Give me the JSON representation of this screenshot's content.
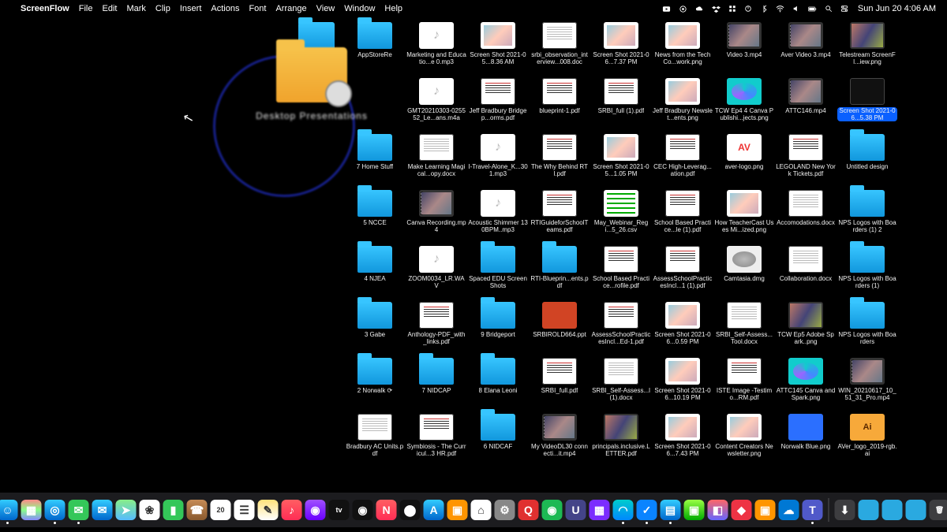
{
  "menubar": {
    "app_name": "ScreenFlow",
    "items": [
      "File",
      "Edit",
      "Mark",
      "Clip",
      "Insert",
      "Actions",
      "Font",
      "Arrange",
      "View",
      "Window",
      "Help"
    ],
    "clock": "Sun Jun 20  4:06 AM",
    "status_icons": [
      "youtube",
      "record",
      "cloud",
      "dropbox",
      "grid",
      "toggl",
      "bluetooth",
      "wifi",
      "volume",
      "battery",
      "search",
      "control-center"
    ]
  },
  "zoom_label": "Desktop Presentations",
  "grid": [
    [
      {
        "kind": "folder",
        "label": "AppStoreRe"
      },
      {
        "kind": "audio",
        "label": "Marketing and Educatio...e 0.mp3"
      },
      {
        "kind": "img",
        "label": "Screen Shot 2021-05...8.36 AM"
      },
      {
        "kind": "doc",
        "label": "srbi_observation_interview...008.doc"
      },
      {
        "kind": "img",
        "label": "Screen Shot 2021-06...7.37 PM"
      },
      {
        "kind": "img",
        "label": "News from the Tech Co...work.png"
      },
      {
        "kind": "video",
        "label": "Video 3.mp4"
      },
      {
        "kind": "video",
        "label": "Aver Video 3.mp4"
      },
      {
        "kind": "photo",
        "label": "Telestream ScreenFl...iew.png"
      }
    ],
    [
      {
        "kind": "empty",
        "label": ""
      },
      {
        "kind": "audio",
        "label": "GMT20210303-025552_Le...ans.m4a"
      },
      {
        "kind": "pdf",
        "label": "Jeff Bradbury Bridgep...orms.pdf"
      },
      {
        "kind": "pdf",
        "label": "blueprint-1.pdf"
      },
      {
        "kind": "pdf",
        "label": "SRBI_full (1).pdf"
      },
      {
        "kind": "img",
        "label": "Jeff Bradbury Newslet...ents.png"
      },
      {
        "kind": "canva",
        "label": "TCW Ep4 4 Canva Publishi...jects.png"
      },
      {
        "kind": "video",
        "label": "ATTC146.mp4"
      },
      {
        "kind": "dark",
        "label": "Screen Shot 2021-06...5.38 PM",
        "selected": true
      }
    ],
    [
      {
        "kind": "folder",
        "label": "7 Home Stuff"
      },
      {
        "kind": "doc",
        "label": "Make Learning Magical...opy.docx"
      },
      {
        "kind": "audio",
        "label": "I-Travel-Alone_K...301.mp3"
      },
      {
        "kind": "pdf",
        "label": "The Why Behind RTI.pdf"
      },
      {
        "kind": "img",
        "label": "Screen Shot 2021-05...1.05 PM"
      },
      {
        "kind": "pdf",
        "label": "CEC High-Leverag...ation.pdf"
      },
      {
        "kind": "aver",
        "label": "aver-logo.png"
      },
      {
        "kind": "pdf",
        "label": "LEGOLAND New York Tickets.pdf"
      },
      {
        "kind": "folder",
        "label": "Untitled design"
      }
    ],
    [
      {
        "kind": "folder",
        "label": "5 NCCE"
      },
      {
        "kind": "video",
        "label": "Canva Recording.mp4"
      },
      {
        "kind": "audio",
        "label": "Acoustic Shimmer 130BPM..mp3"
      },
      {
        "kind": "pdf",
        "label": "RTIGuideforSchoolTeams.pdf"
      },
      {
        "kind": "spread",
        "label": "May_Webinar_Regi...5_26.csv"
      },
      {
        "kind": "pdf",
        "label": "School Based Practice...le (1).pdf"
      },
      {
        "kind": "img",
        "label": "How TeacherCast Uses Mi...ized.png"
      },
      {
        "kind": "doc",
        "label": "Accomodations.docx"
      },
      {
        "kind": "folder",
        "label": "NPS Logos with Boarders (1) 2"
      }
    ],
    [
      {
        "kind": "folder",
        "label": "4 NJEA"
      },
      {
        "kind": "audio",
        "label": "ZOOM0034_LR.WAV"
      },
      {
        "kind": "folder",
        "label": "Spaced EDU Screen Shots"
      },
      {
        "kind": "folder",
        "label": "RTI-Blueprin...ents.pdf"
      },
      {
        "kind": "pdf",
        "label": "School Based Practice...rofile.pdf"
      },
      {
        "kind": "pdf",
        "label": "AssessSchoolPracticesIncl...1 (1).pdf"
      },
      {
        "kind": "dmg",
        "label": "Camtasia.dmg"
      },
      {
        "kind": "doc",
        "label": "Collaboration.docx"
      },
      {
        "kind": "folder",
        "label": "NPS Logos with Boarders (1)"
      }
    ],
    [
      {
        "kind": "folder",
        "label": "3 Gabe"
      },
      {
        "kind": "pdf",
        "label": "Anthology-PDF_with_links.pdf"
      },
      {
        "kind": "folder",
        "label": "9 Bridgeport"
      },
      {
        "kind": "ppt",
        "label": "SRBIROLD664.ppt"
      },
      {
        "kind": "pdf",
        "label": "AssessSchoolPracticesIncl...Ed-1.pdf"
      },
      {
        "kind": "img",
        "label": "Screen Shot 2021-06...0.59 PM"
      },
      {
        "kind": "doc",
        "label": "SRBI_Self-Assess...Tool.docx"
      },
      {
        "kind": "photo",
        "label": "TCW Ep5 Adobe Spark..png"
      },
      {
        "kind": "folder",
        "label": "NPS Logos with Boarders"
      }
    ],
    [
      {
        "kind": "folder",
        "label": "2 Norwalk ⟳"
      },
      {
        "kind": "folder",
        "label": "7 NIDCAP"
      },
      {
        "kind": "folder",
        "label": "8 Elana Leoni"
      },
      {
        "kind": "pdf",
        "label": "SRBI_full.pdf"
      },
      {
        "kind": "doc",
        "label": "SRBI_Self-Assess...l (1).docx"
      },
      {
        "kind": "img",
        "label": "Screen Shot 2021-06...10.19 PM"
      },
      {
        "kind": "pdf",
        "label": "ISTE Image -Testimo...RM.pdf"
      },
      {
        "kind": "canva",
        "label": "ATTC145 Canva and Spark.png"
      },
      {
        "kind": "video",
        "label": "WIN_20210617_10_51_31_Pro.mp4"
      }
    ],
    [
      {
        "kind": "doc",
        "label": "Bradbury AC Units.pdf"
      },
      {
        "kind": "pdf",
        "label": "Symbiosis - The Curricul...3 HR.pdf"
      },
      {
        "kind": "folder",
        "label": "6 NIDCAF"
      },
      {
        "kind": "video",
        "label": "My VideoDL30 connecti...it.mp4"
      },
      {
        "kind": "photo",
        "label": "principals.inclusive.LETTER.pdf"
      },
      {
        "kind": "img",
        "label": "Screen Shot 2021-06...7.43 PM"
      },
      {
        "kind": "img",
        "label": "Content Creators Newsletter.png"
      },
      {
        "kind": "blue",
        "label": "Norwalk Blue.png"
      },
      {
        "kind": "ai",
        "label": "AVer_logo_2019-rgb.ai"
      }
    ]
  ],
  "dock": [
    {
      "name": "finder",
      "bg": "linear-gradient(#3cf,#06c)",
      "glyph": "☺",
      "running": true
    },
    {
      "name": "launchpad",
      "bg": "linear-gradient(#f88,#8f8,#88f)",
      "glyph": "▦"
    },
    {
      "name": "safari",
      "bg": "linear-gradient(#3cf,#06c)",
      "glyph": "◎",
      "running": true
    },
    {
      "name": "messages",
      "bg": "#34c759",
      "glyph": "✉",
      "running": true
    },
    {
      "name": "mail",
      "bg": "linear-gradient(#3cf,#06c)",
      "glyph": "✉"
    },
    {
      "name": "maps",
      "bg": "linear-gradient(#8e8,#5bf)",
      "glyph": "➤"
    },
    {
      "name": "photos",
      "bg": "#fff",
      "glyph": "❀"
    },
    {
      "name": "facetime",
      "bg": "#34c759",
      "glyph": "▮"
    },
    {
      "name": "contacts",
      "bg": "linear-gradient(#c58b56,#8a5a2e)",
      "glyph": "☎"
    },
    {
      "name": "calendar",
      "bg": "#fff",
      "glyph": "20"
    },
    {
      "name": "reminders",
      "bg": "#fff",
      "glyph": "☰"
    },
    {
      "name": "notes",
      "bg": "linear-gradient(#ffe27a,#fff)",
      "glyph": "✎"
    },
    {
      "name": "music",
      "bg": "linear-gradient(#ff5e62,#ff2d55)",
      "glyph": "♪"
    },
    {
      "name": "podcasts",
      "bg": "linear-gradient(#a050ff,#6a00ff)",
      "glyph": "◉"
    },
    {
      "name": "tv",
      "bg": "#111",
      "glyph": "tv"
    },
    {
      "name": "voice-memos",
      "bg": "#111",
      "glyph": "◉"
    },
    {
      "name": "news",
      "bg": "linear-gradient(#ff5e62,#ff2d55)",
      "glyph": "N"
    },
    {
      "name": "stocks",
      "bg": "#111",
      "glyph": "⬤"
    },
    {
      "name": "appstore",
      "bg": "linear-gradient(#3cf,#06c)",
      "glyph": "A"
    },
    {
      "name": "books",
      "bg": "#ff9500",
      "glyph": "▣"
    },
    {
      "name": "home",
      "bg": "#fff",
      "glyph": "⌂"
    },
    {
      "name": "system-prefs",
      "bg": "#888",
      "glyph": "⚙"
    },
    {
      "name": "quicken",
      "bg": "#e03030",
      "glyph": "Q"
    },
    {
      "name": "spotify",
      "bg": "#1db954",
      "glyph": "◉"
    },
    {
      "name": "app-u",
      "bg": "#448",
      "glyph": "U"
    },
    {
      "name": "app-p",
      "bg": "#7b2dff",
      "glyph": "▦"
    },
    {
      "name": "edge",
      "bg": "linear-gradient(#0cc,#08f)",
      "glyph": "◠",
      "running": true
    },
    {
      "name": "things",
      "bg": "#0a84ff",
      "glyph": "✓",
      "running": true
    },
    {
      "name": "preview",
      "bg": "linear-gradient(#3cf,#06c)",
      "glyph": "▤",
      "running": true
    },
    {
      "name": "app-green",
      "bg": "linear-gradient(#9f4,#0a0)",
      "glyph": "▣"
    },
    {
      "name": "app-color",
      "bg": "linear-gradient(#f66,#66f)",
      "glyph": "◧"
    },
    {
      "name": "anydesk",
      "bg": "#ee3344",
      "glyph": "◆"
    },
    {
      "name": "app-orange",
      "bg": "#ff9500",
      "glyph": "▣"
    },
    {
      "name": "onedrive",
      "bg": "#0078d4",
      "glyph": "☁"
    },
    {
      "name": "teams",
      "bg": "#5059c9",
      "glyph": "T",
      "running": true
    }
  ],
  "dock_right": [
    {
      "name": "downloads",
      "bg": "rgba(255,255,255,0.15)",
      "glyph": "⬇"
    },
    {
      "name": "folder1",
      "bg": "#2aa9e0",
      "glyph": ""
    },
    {
      "name": "folder2",
      "bg": "#2aa9e0",
      "glyph": ""
    },
    {
      "name": "folder3",
      "bg": "#2aa9e0",
      "glyph": ""
    },
    {
      "name": "trash",
      "bg": "rgba(255,255,255,0.15)",
      "glyph": "🗑"
    }
  ]
}
